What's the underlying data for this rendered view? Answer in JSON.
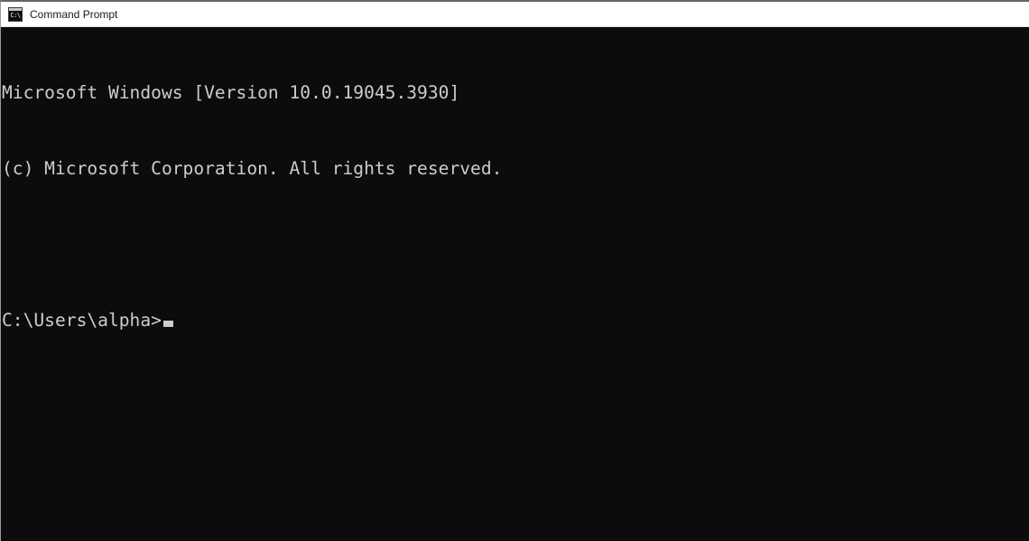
{
  "window": {
    "title": "Command Prompt",
    "icon": "console-window-icon",
    "icon_glyph": "C:\\",
    "background_color": "#0c0c0c",
    "titlebar_color": "#ffffff",
    "text_color": "#cccccc"
  },
  "console": {
    "lines": [
      {
        "text": "Microsoft Windows [Version 10.0.19045.3930]",
        "blank": false
      },
      {
        "text": "(c) Microsoft Corporation. All rights reserved.",
        "blank": false
      },
      {
        "text": "",
        "blank": true
      }
    ],
    "prompt": "C:\\Users\\alpha>",
    "input_value": "",
    "cursor": "block-cursor"
  }
}
